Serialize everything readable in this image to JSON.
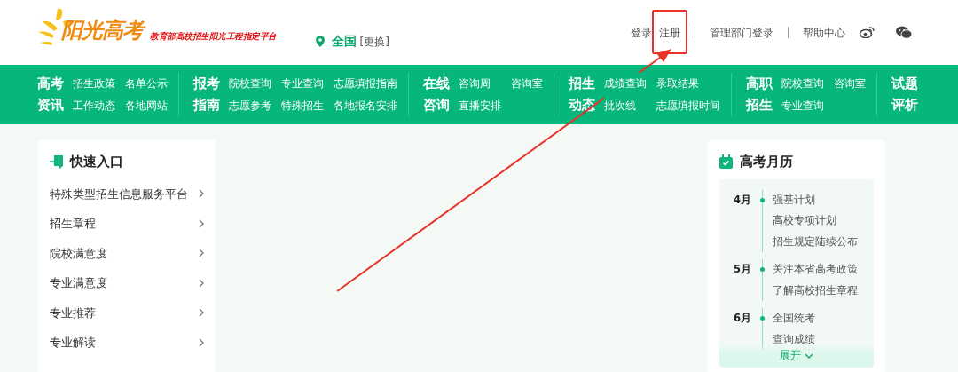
{
  "logo": {
    "title": "阳光高考",
    "tagline": "教育部高校招生阳光工程指定平台"
  },
  "location": {
    "region": "全国",
    "change": "[更换]"
  },
  "top_links": [
    {
      "label": "登录"
    },
    {
      "label": "注册",
      "highlighted": true
    },
    {
      "label": "管理部门登录"
    },
    {
      "label": "帮助中心"
    }
  ],
  "nav": [
    {
      "heading": [
        "高考",
        "资讯"
      ],
      "links": [
        "招生政策",
        "名单公示",
        "工作动态",
        "各地网站"
      ]
    },
    {
      "heading": [
        "报考",
        "指南"
      ],
      "links": [
        "院校查询",
        "专业查询",
        "志愿填报指南",
        "志愿参考",
        "特殊招生",
        "各地报名安排"
      ]
    },
    {
      "heading": [
        "在线",
        "咨询"
      ],
      "links": [
        "咨询周",
        "咨询室",
        "直播安排"
      ]
    },
    {
      "heading": [
        "招生",
        "动态"
      ],
      "links": [
        "成绩查询",
        "录取结果",
        "批次线",
        "志愿填报时间"
      ]
    },
    {
      "heading": [
        "高职",
        "招生"
      ],
      "links": [
        "院校查询",
        "咨询室",
        "专业查询"
      ]
    },
    {
      "heading": [
        "试题",
        "评析"
      ]
    }
  ],
  "quick_entry": {
    "title": "快速入口",
    "items": [
      "特殊类型招生信息服务平台",
      "招生章程",
      "院校满意度",
      "专业满意度",
      "专业推荐",
      "专业解读"
    ]
  },
  "calendar": {
    "title": "高考月历",
    "months": [
      {
        "month": "4月",
        "events": [
          "强基计划",
          "高校专项计划",
          "招生规定陆续公布"
        ]
      },
      {
        "month": "5月",
        "events": [
          "关注本省高考政策",
          "了解高校招生章程"
        ]
      },
      {
        "month": "6月",
        "events": [
          "全国统考",
          "查询成绩"
        ]
      }
    ],
    "expand": "展开"
  }
}
